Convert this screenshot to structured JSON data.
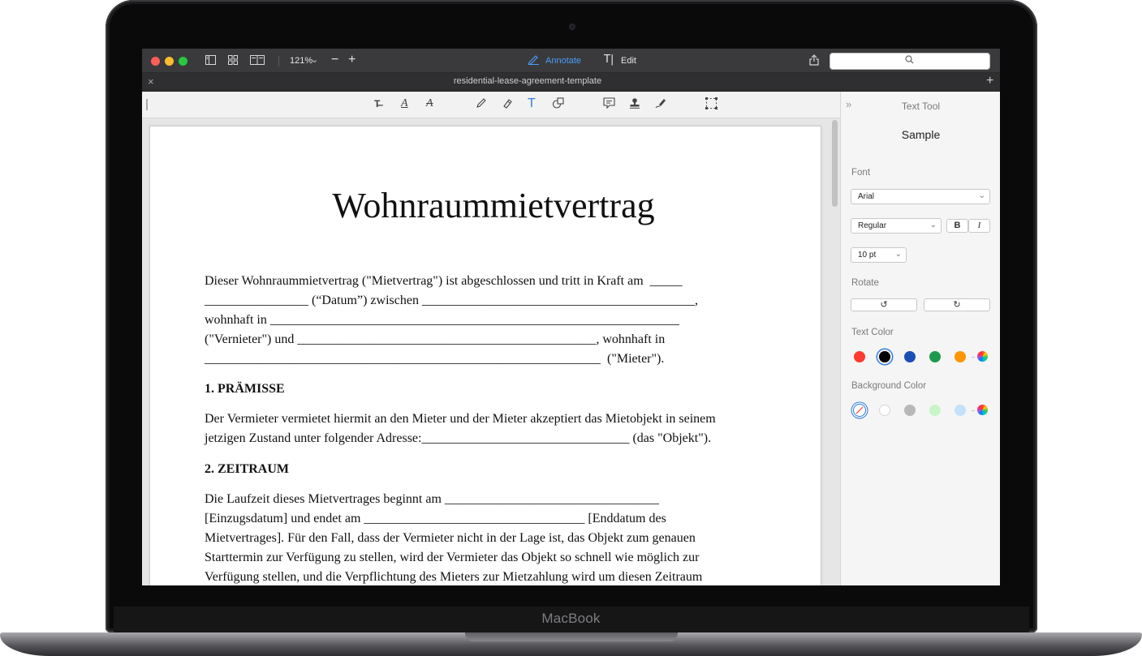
{
  "device": {
    "brand": "MacBook"
  },
  "window": {
    "zoom": "121%",
    "modes": {
      "annotate": "Annotate",
      "edit": "Edit"
    },
    "tab_title": "residential-lease-agreement-template"
  },
  "document": {
    "title": "Wohnraummietvertrag",
    "intro_lines": [
      "Dieser Wohnraummietvertrag (\"Mietvertrag\") ist abgeschlossen und tritt in Kraft am  _____",
      "________________ (“Datum”) zwischen __________________________________________,",
      "wohnhaft in _______________________________________________________________",
      "(\"Vernieter\") und ______________________________________________, wohnhaft in",
      "_____________________________________________________________  (\"Mieter\")."
    ],
    "section1_heading": "1. PRÄMISSE",
    "section1_lines": [
      "Der Vermieter vermietet hiermit an den Mieter und der Mieter akzeptiert das Mietobjekt in seinem",
      "jetzigen Zustand unter folgender Adresse:________________________________ (das \"Objekt\")."
    ],
    "section2_heading": "2. ZEITRAUM",
    "section2_lines": [
      "Die Laufzeit dieses Mietvertrages beginnt am _________________________________",
      "[Einzugsdatum] und endet am __________________________________ [Enddatum des",
      "Mietvertrages]. Für den Fall, dass der Vermieter nicht in der Lage ist, das Objekt zum genauen",
      "Starttermin zur Verfügung zu stellen, wird der Vermieter das Objekt so schnell wie möglich zur",
      "Verfügung stellen, und die Verpflichtung des Mieters zur Mietzahlung wird um diesen Zeitraum"
    ]
  },
  "sidebar": {
    "title": "Text Tool",
    "sample": "Sample",
    "font_label": "Font",
    "font_value": "Arial",
    "style_value": "Regular",
    "bold_label": "B",
    "italic_label": "I",
    "size_value": "10 pt",
    "rotate_label": "Rotate",
    "text_color_label": "Text Color",
    "background_color_label": "Background Color",
    "text_colors": [
      "#ff3b30",
      "#000000",
      "#1a4fb5",
      "#1e9a4e",
      "#ff9500"
    ],
    "background_colors": [
      "none",
      "#ffffff",
      "#b8b8b8",
      "#c8f5c8",
      "#c4e0fb"
    ]
  },
  "colors": {
    "accent": "#2f7de1",
    "titlebar": "#3a3a3c"
  }
}
